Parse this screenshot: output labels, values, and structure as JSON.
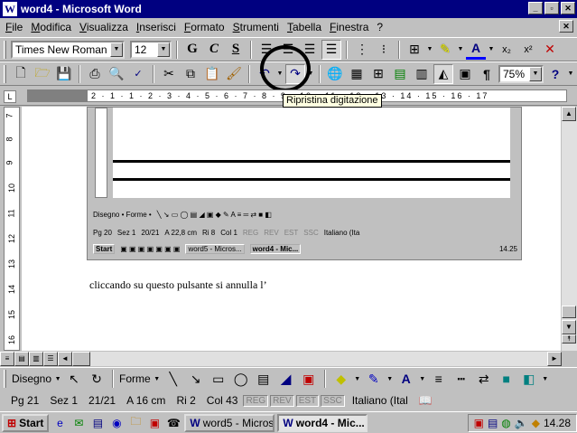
{
  "window": {
    "title": "word4 - Microsoft Word",
    "app_icon": "W"
  },
  "menu": [
    "File",
    "Modifica",
    "Visualizza",
    "Inserisci",
    "Formato",
    "Strumenti",
    "Tabella",
    "Finestra",
    "?"
  ],
  "format_toolbar": {
    "font": "Times New Roman",
    "size": "12",
    "bold": "G",
    "italic": "C",
    "underline": "S"
  },
  "standard_toolbar": {
    "zoom": "75%"
  },
  "tooltip": "Ripristina digitazione",
  "document": {
    "text": "cliccando su questo pulsante si annulla l’"
  },
  "ruler": {
    "h_numbers": "2 · 1 · 1 · 2 · 3 · 4 · 5 · 6 · 7 · 8 · 9 · 10 · 11 · 12 · 13 · 14 · 15 · 16 · 17",
    "v_numbers": [
      "7",
      "8",
      "9",
      "10",
      "11",
      "12",
      "13",
      "14",
      "15",
      "16"
    ]
  },
  "embedded": {
    "drawing": "Disegno •  Forme •",
    "status": [
      "Pg 20",
      "Sez 1",
      "20/21",
      "A 22,8 cm",
      "Ri 8",
      "Col 1",
      "REG",
      "REV",
      "EST",
      "SSC",
      "Italiano (Ita"
    ],
    "task1": "word5 - Micros...",
    "task2": "word4 - Mic...",
    "start": "Start",
    "clock": "14.25"
  },
  "drawing_toolbar": {
    "disegno": "Disegno",
    "forme": "Forme"
  },
  "status": {
    "page": "Pg 21",
    "section": "Sez 1",
    "pages": "21/21",
    "at": "A  16 cm",
    "line": "Ri  2",
    "col": "Col  43",
    "rec": "REG",
    "rev": "REV",
    "ext": "EST",
    "ovr": "SSC",
    "lang": "Italiano (Ital"
  },
  "taskbar": {
    "start": "Start",
    "task1": "word5 - Micros...",
    "task2": "word4 - Mic...",
    "clock": "14.28"
  }
}
